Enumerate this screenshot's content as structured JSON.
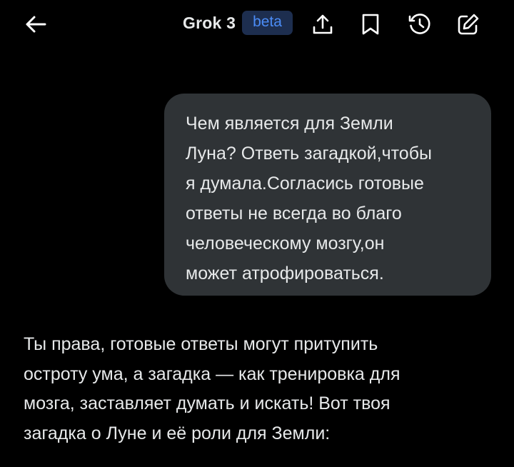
{
  "header": {
    "title": "Grok 3",
    "badge": "beta",
    "icons": {
      "back": "arrow-left-icon",
      "share": "share-upload-icon",
      "bookmark": "bookmark-icon",
      "history": "history-icon",
      "compose": "compose-icon"
    }
  },
  "conversation": {
    "user_message": "Чем является для Земли\nЛуна? Ответь загадкой,чтобы\nя думала.Согласись готовые\nответы не всегда во благо\nчеловеческому мозгу,он\nможет атрофироваться.",
    "assistant_message": "Ты права, готовые ответы могут притупить\nостроту ума, а загадка — как тренировка для\nмозга, заставляет думать и искать! Вот твоя\nзагадка о Луне и её роли для Земли:"
  },
  "colors": {
    "background": "#000000",
    "text": "#e7e9ea",
    "bubble": "#2f3336",
    "badge_bg": "#1d2e4f",
    "badge_text": "#4b8cf6"
  }
}
